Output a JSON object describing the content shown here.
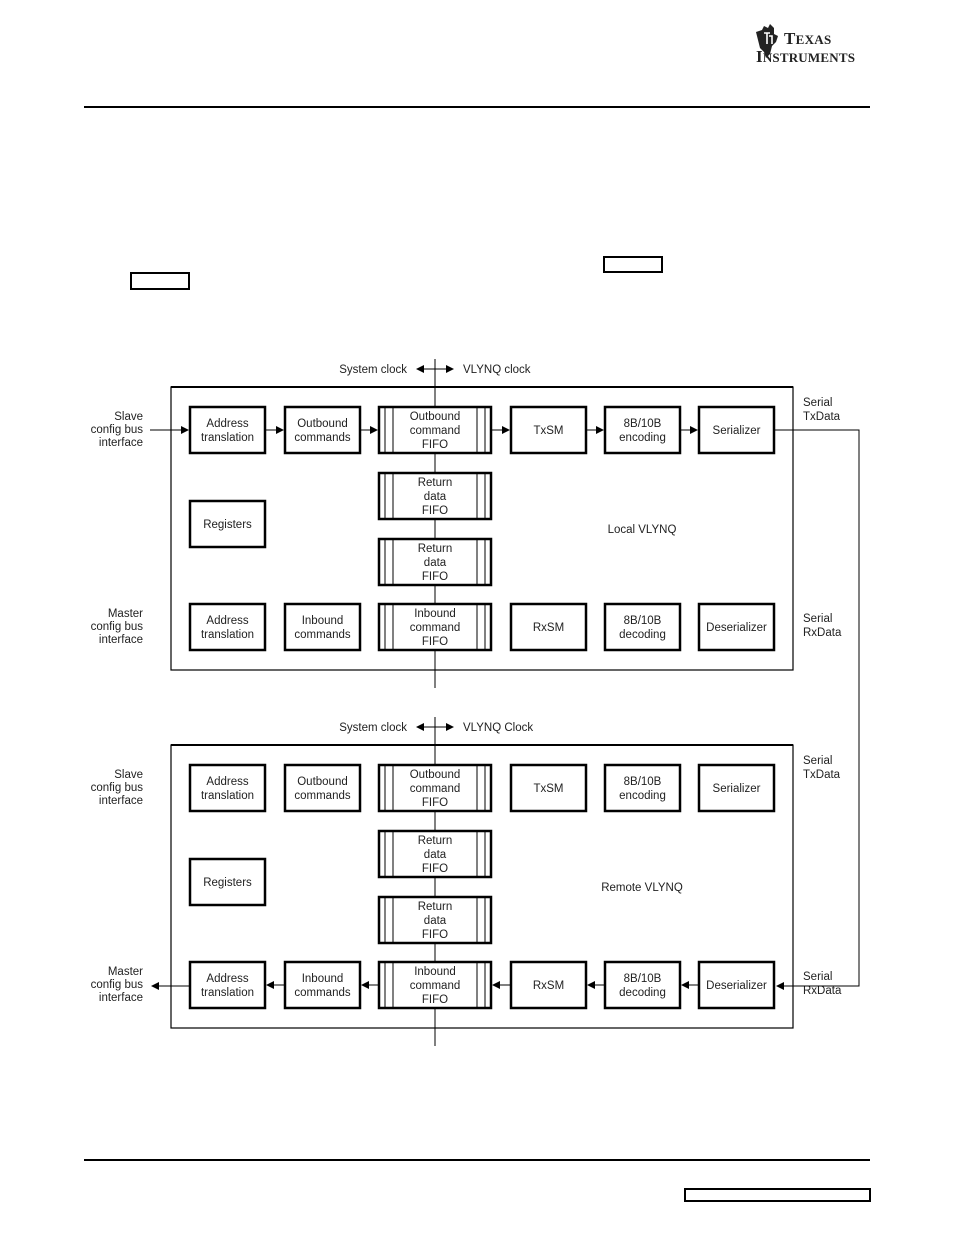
{
  "header": {
    "brand": {
      "line1_first": "T",
      "line1_rest": "EXAS",
      "line2_first": "I",
      "line2_rest": "NSTRUMENTS",
      "icon": "ti-state-logo-icon"
    }
  },
  "diagram": {
    "clock_labels": {
      "local": {
        "left": "System clock",
        "right": "VLYNQ clock"
      },
      "remote": {
        "left": "System clock",
        "right": "VLYNQ Clock"
      }
    },
    "external_labels": {
      "slave": [
        "Slave",
        "config bus",
        "interface"
      ],
      "master": [
        "Master",
        "config bus",
        "interface"
      ],
      "serial_tx": [
        "Serial",
        "TxData"
      ],
      "serial_rx": [
        "Serial",
        "RxData"
      ]
    },
    "modules": [
      {
        "name": "Local VLYNQ",
        "top_row": [
          {
            "id": "address-translation",
            "lines": [
              "Address",
              "translation"
            ],
            "fifo": false
          },
          {
            "id": "outbound-commands",
            "lines": [
              "Outbound",
              "commands"
            ],
            "fifo": false
          },
          {
            "id": "outbound-command-fifo",
            "lines": [
              "Outbound",
              "command",
              "FIFO"
            ],
            "fifo": true
          },
          {
            "id": "txsm",
            "lines": [
              "TxSM"
            ],
            "fifo": false
          },
          {
            "id": "encoding",
            "lines": [
              "8B/10B",
              "encoding"
            ],
            "fifo": false
          },
          {
            "id": "serializer",
            "lines": [
              "Serializer"
            ],
            "fifo": false
          }
        ],
        "registers": [
          "Registers"
        ],
        "return_fifos": [
          [
            "Return",
            "data",
            "FIFO"
          ],
          [
            "Return",
            "data",
            "FIFO"
          ]
        ],
        "bottom_row": [
          {
            "id": "address-translation",
            "lines": [
              "Address",
              "translation"
            ],
            "fifo": false
          },
          {
            "id": "inbound-commands",
            "lines": [
              "Inbound",
              "commands"
            ],
            "fifo": false
          },
          {
            "id": "inbound-command-fifo",
            "lines": [
              "Inbound",
              "command",
              "FIFO"
            ],
            "fifo": true
          },
          {
            "id": "rxsm",
            "lines": [
              "RxSM"
            ],
            "fifo": false
          },
          {
            "id": "decoding",
            "lines": [
              "8B/10B",
              "decoding"
            ],
            "fifo": false
          },
          {
            "id": "deserializer",
            "lines": [
              "Deserializer"
            ],
            "fifo": false
          }
        ],
        "top_row_arrows": true,
        "bottom_row_arrows": false
      },
      {
        "name": "Remote VLYNQ",
        "top_row": [
          {
            "id": "address-translation",
            "lines": [
              "Address",
              "translation"
            ],
            "fifo": false
          },
          {
            "id": "outbound-commands",
            "lines": [
              "Outbound",
              "commands"
            ],
            "fifo": false
          },
          {
            "id": "outbound-command-fifo",
            "lines": [
              "Outbound",
              "command",
              "FIFO"
            ],
            "fifo": true
          },
          {
            "id": "txsm",
            "lines": [
              "TxSM"
            ],
            "fifo": false
          },
          {
            "id": "encoding",
            "lines": [
              "8B/10B",
              "encoding"
            ],
            "fifo": false
          },
          {
            "id": "serializer",
            "lines": [
              "Serializer"
            ],
            "fifo": false
          }
        ],
        "registers": [
          "Registers"
        ],
        "return_fifos": [
          [
            "Return",
            "data",
            "FIFO"
          ],
          [
            "Return",
            "data",
            "FIFO"
          ]
        ],
        "bottom_row": [
          {
            "id": "address-translation",
            "lines": [
              "Address",
              "translation"
            ],
            "fifo": false
          },
          {
            "id": "inbound-commands",
            "lines": [
              "Inbound",
              "commands"
            ],
            "fifo": false
          },
          {
            "id": "inbound-command-fifo",
            "lines": [
              "Inbound",
              "command",
              "FIFO"
            ],
            "fifo": true
          },
          {
            "id": "rxsm",
            "lines": [
              "RxSM"
            ],
            "fifo": false
          },
          {
            "id": "decoding",
            "lines": [
              "8B/10B",
              "decoding"
            ],
            "fifo": false
          },
          {
            "id": "deserializer",
            "lines": [
              "Deserializer"
            ],
            "fifo": false
          }
        ],
        "top_row_arrows": false,
        "bottom_row_arrows": true
      }
    ]
  }
}
